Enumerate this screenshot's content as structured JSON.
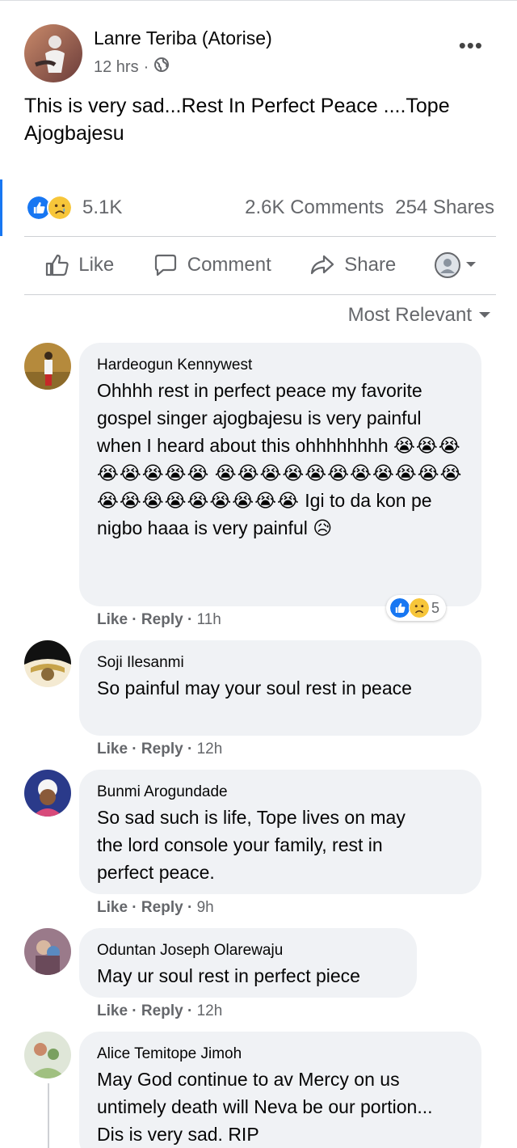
{
  "post": {
    "author": "Lanre Teriba (Atorise)",
    "time": "12 hrs",
    "separator": "·",
    "privacy_icon": "globe-icon",
    "more_label": "•••",
    "text": "This is very sad...Rest In Perfect Peace ....Tope Ajogbajesu"
  },
  "stats": {
    "reactions_count": "5.1K",
    "comments": "2.6K Comments",
    "shares": "254 Shares",
    "reaction_icons": [
      "like-icon",
      "sad-icon"
    ]
  },
  "actions": {
    "like": "Like",
    "comment": "Comment",
    "share": "Share"
  },
  "sort": {
    "label": "Most Relevant"
  },
  "colors": {
    "accent": "#1877f2",
    "bubble": "#f0f2f5",
    "muted": "#65676b"
  },
  "comments": [
    {
      "name": "Hardeogun Kennywest",
      "text_1": "Ohhhh rest in perfect peace my favorite gospel singer ajogbajesu is very painful when I heard about this ohhhhhhhh",
      "emoji_a": "😭😭😭😭😭😭😭😭",
      "emoji_b": "😭😭😭😭😭😭😭😭😭😭😭😭😭😭😭😭😭😭😭😭",
      "text_2": "Igi to da kon pe nigbo haaa is very painful",
      "emoji_c": "😥",
      "like": "Like",
      "reply": "Reply",
      "time": "11h",
      "reaction_count": "5"
    },
    {
      "name": "Soji Ilesanmi",
      "text": "So painful may your soul rest in peace",
      "like": "Like",
      "reply": "Reply",
      "time": "12h"
    },
    {
      "name": "Bunmi Arogundade",
      "text": "So sad such is life, Tope lives on may the lord console your family, rest in perfect peace.",
      "like": "Like",
      "reply": "Reply",
      "time": "9h"
    },
    {
      "name": "Oduntan Joseph Olarewaju",
      "text": "May ur soul rest in perfect piece",
      "like": "Like",
      "reply": "Reply",
      "time": "12h"
    },
    {
      "name": "Alice Temitope Jimoh",
      "text": "May God continue to av Mercy on us untimely death will Neva be our portion... Dis is very sad. RIP"
    }
  ]
}
